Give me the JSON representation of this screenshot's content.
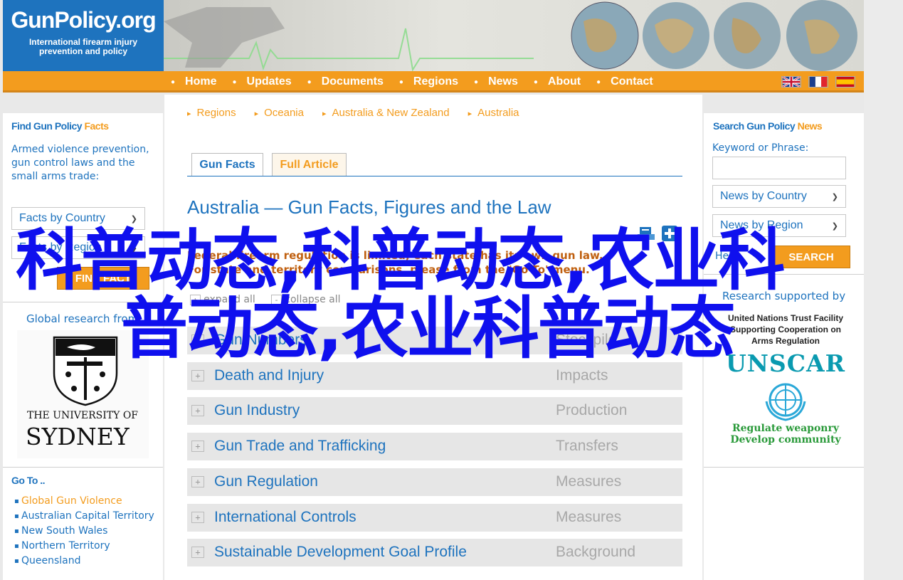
{
  "header": {
    "logo_name": "GunPolicy.org",
    "logo_tagline_1": "International firearm injury",
    "logo_tagline_2": "prevention and policy"
  },
  "nav": {
    "items": [
      "Home",
      "Updates",
      "Documents",
      "Regions",
      "News",
      "About",
      "Contact"
    ],
    "flags": [
      "uk-flag",
      "france-flag",
      "spain-flag"
    ]
  },
  "left": {
    "heading_part1": "Find Gun Policy",
    "heading_part2": "Facts",
    "description": "Armed violence prevention, gun control laws and the small arms trade:",
    "select_country": "Facts by Country",
    "select_region": "Facts by Region",
    "find_button": "FIND FACT",
    "global_research": "Global research from",
    "uni_line1": "THE UNIVERSITY OF",
    "uni_line2": "SYDNEY",
    "goto_heading": "Go To ..",
    "goto_items": [
      "Global Gun Violence",
      "Australian Capital Territory",
      "New South Wales",
      "Northern Territory",
      "Queensland"
    ]
  },
  "center": {
    "breadcrumbs": [
      "Regions",
      "Oceania",
      "Australia & New Zealand",
      "Australia"
    ],
    "tab_facts": "Gun Facts",
    "tab_article": "Full Article",
    "title": "Australia — Gun Facts, Figures and the Law",
    "intro_line1": "Federal firearm regulation is limited; each state has its own gun law.",
    "intro_line2": "For state and territory comparisons, please from the 'Go To' menu.",
    "expand_all": "expand all",
    "collapse_all": "collapse all",
    "rows": [
      {
        "label": "Gun Numbers",
        "category": "Stockpile"
      },
      {
        "label": "Death and Injury",
        "category": "Impacts"
      },
      {
        "label": "Gun Industry",
        "category": "Production"
      },
      {
        "label": "Gun Trade and Trafficking",
        "category": "Transfers"
      },
      {
        "label": "Gun Regulation",
        "category": "Measures"
      },
      {
        "label": "International Controls",
        "category": "Measures"
      },
      {
        "label": "Sustainable Development Goal Profile",
        "category": "Background"
      }
    ]
  },
  "right": {
    "heading_part1": "Search Gun Policy",
    "heading_part2": "News",
    "keyword_label": "Keyword or Phrase:",
    "keyword_value": "",
    "select_country": "News by Country",
    "select_region": "News by Region",
    "help": "Help",
    "search_button": "SEARCH",
    "supported_by": "Research supported by",
    "trust_line1": "United Nations Trust Facility",
    "trust_line2": "Supporting Cooperation on",
    "trust_line3": "Arms Regulation",
    "unscar": "UNSCAR",
    "slogan1": "Regulate weaponry",
    "slogan2": "Develop community"
  },
  "overlay": {
    "line1": "科普动态,科普动态,农业科",
    "line2": "普动态,农业科普动态"
  },
  "colors": {
    "blue": "#1e73be",
    "orange": "#f39c1e",
    "overlay_blue": "#0f10ee",
    "unscar_teal": "#0a9ab0",
    "slogan_green": "#2a9a3a"
  }
}
